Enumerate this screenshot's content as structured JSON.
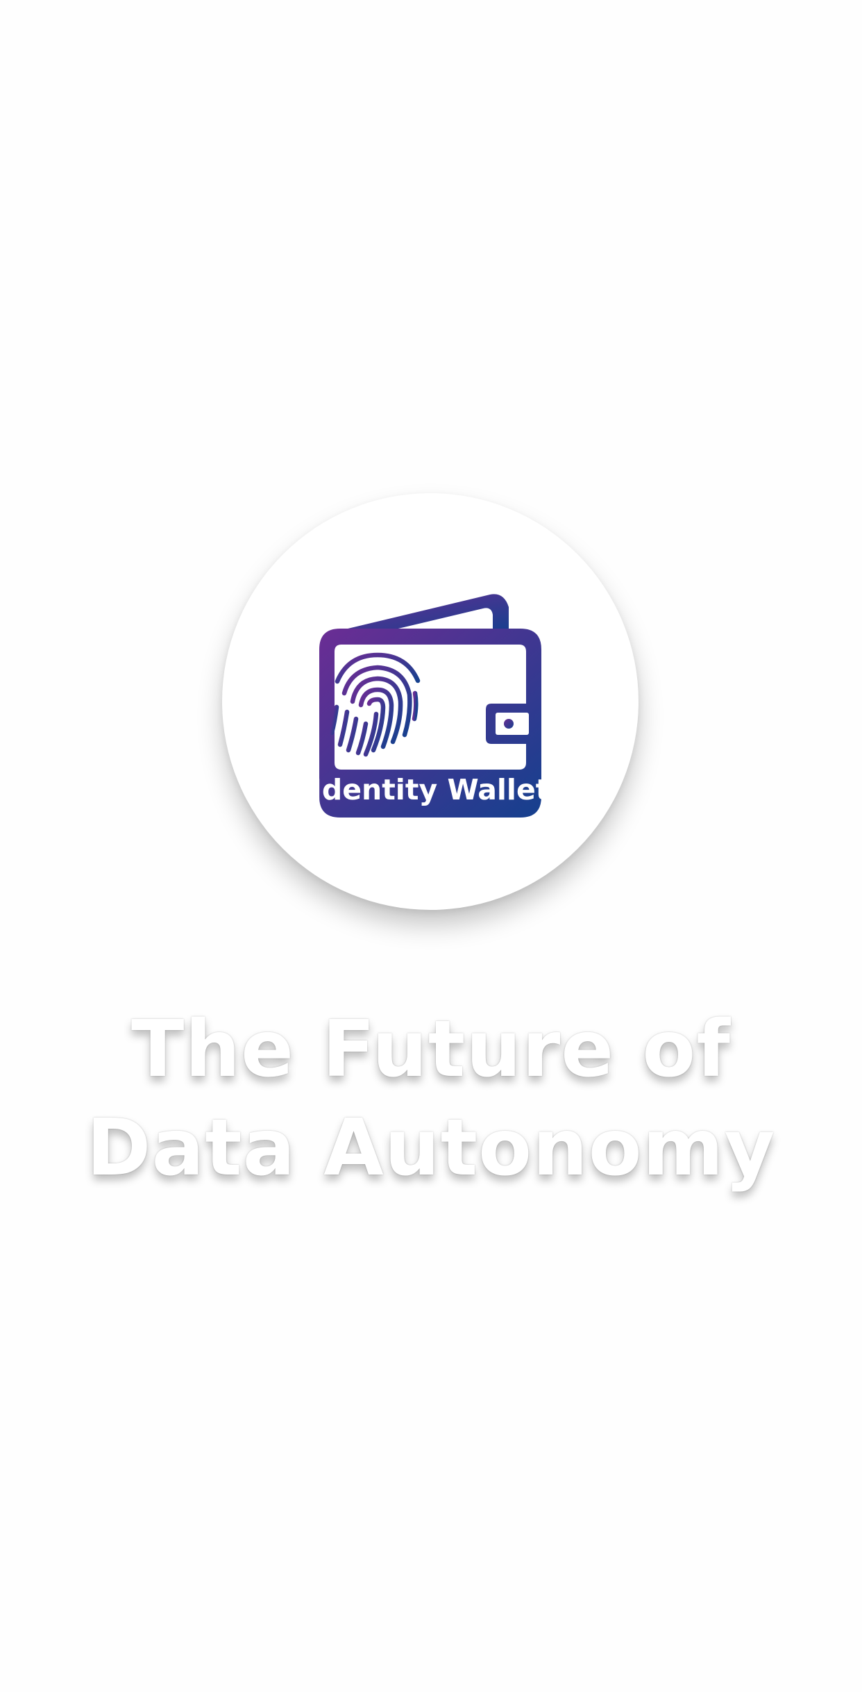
{
  "logo": {
    "icon": "wallet-fingerprint-icon",
    "label": "Identity Wallet",
    "gradient_start": "#6b2d94",
    "gradient_end": "#15408e"
  },
  "tagline": {
    "line1": "The Future of",
    "line2": "Data Autonomy"
  },
  "colors": {
    "background": "#ffffff",
    "tagline_text": "#ffffff"
  }
}
